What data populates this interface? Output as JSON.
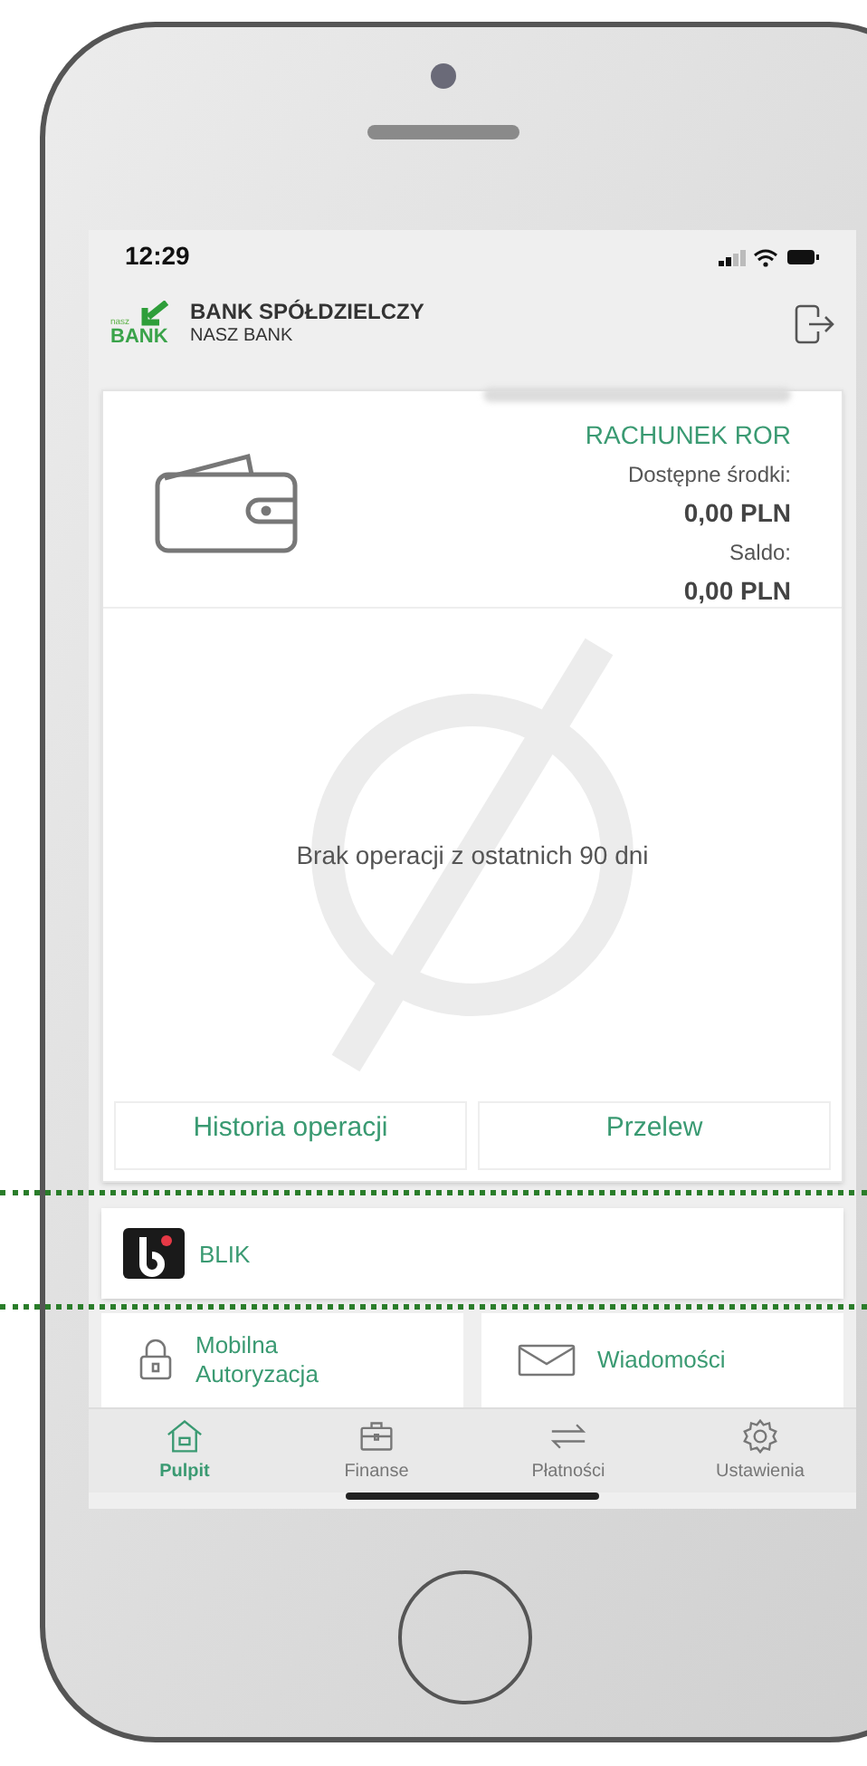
{
  "status_bar": {
    "time": "12:29"
  },
  "header": {
    "logo_small": "nasz",
    "logo_big": "BANK",
    "bank_name": "BANK SPÓŁDZIELCZY",
    "bank_subname": "NASZ BANK"
  },
  "account": {
    "name": "RACHUNEK ROR",
    "available_label": "Dostępne środki:",
    "available": "0,00 PLN",
    "balance_label": "Saldo:",
    "balance": "0,00 PLN"
  },
  "empty_state": "Brak operacji z ostatnich 90 dni",
  "account_actions": [
    "Historia operacji",
    "Przelew"
  ],
  "blik": {
    "label": "BLIK"
  },
  "tiles": [
    {
      "kind": "lock",
      "label": "Mobilna Autoryzacja"
    },
    {
      "kind": "mail",
      "label": "Wiadomości"
    }
  ],
  "tab_bar": [
    {
      "kind": "home",
      "label": "Pulpit",
      "selected": true
    },
    {
      "kind": "briefcase",
      "label": "Finanse",
      "selected": false
    },
    {
      "kind": "transfer",
      "label": "Płatności",
      "selected": false
    },
    {
      "kind": "gear",
      "label": "Ustawienia",
      "selected": false
    }
  ]
}
